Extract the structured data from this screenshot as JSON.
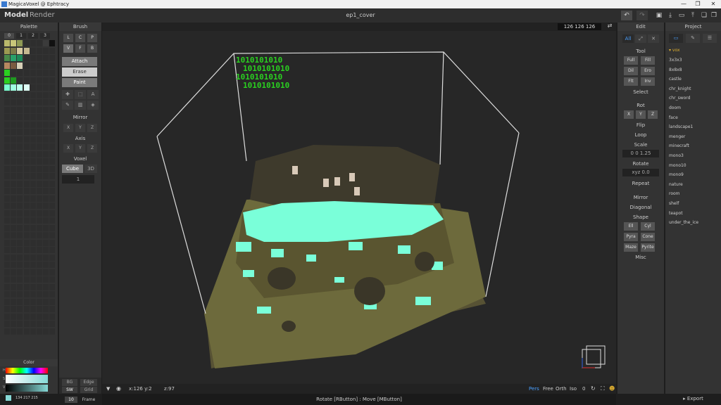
{
  "titlebar": {
    "title": "MagicaVoxel @ Ephtracy",
    "controls": [
      "—",
      "❐",
      "✕"
    ]
  },
  "menubar": {
    "model": "Model",
    "render": "Render",
    "file_title": "ep1_cover"
  },
  "palette": {
    "header": "Palette",
    "tabs": [
      "0",
      "1",
      "2",
      "3"
    ],
    "colors": [
      [
        "#b9b86c",
        "#c8c67a",
        "#8f9a55",
        "#2e2e2e",
        "#2e2e2e",
        "#2e2e2e",
        "#3b3b3b",
        "#111111"
      ],
      [
        "#9c9a52",
        "#7c7a48",
        "#d6c9a0",
        "#c5b890",
        "#2e2e2e",
        "#2e2e2e",
        "#2e2e2e",
        "#2e2e2e"
      ],
      [
        "#4a8a4a",
        "#2aa06a",
        "#1e8a5a",
        "#2e2e2e",
        "#2e2e2e",
        "#2e2e2e",
        "#2e2e2e",
        "#2e2e2e"
      ],
      [
        "#b88860",
        "#7a5a40",
        "#d8d0b8",
        "#2e2e2e",
        "#2e2e2e",
        "#2e2e2e",
        "#2e2e2e",
        "#2e2e2e"
      ],
      [
        "#2ad020",
        "#2e2e2e",
        "#2e2e2e",
        "#2e2e2e",
        "#2e2e2e",
        "#2e2e2e",
        "#2e2e2e",
        "#2e2e2e"
      ],
      [
        "#2ad020",
        "#1e9a20",
        "#2e2e2e",
        "#2e2e2e",
        "#2e2e2e",
        "#2e2e2e",
        "#2e2e2e",
        "#2e2e2e"
      ],
      [
        "#7affd0",
        "#9effe0",
        "#bfffee",
        "#dffff6",
        "#2e2e2e",
        "#2e2e2e",
        "#2e2e2e",
        "#2e2e2e"
      ]
    ],
    "color_header": "Color",
    "color_values": "134 217 215"
  },
  "brush": {
    "header": "Brush",
    "grid": [
      "L",
      "C",
      "P",
      "V",
      "F",
      "B"
    ],
    "actions": [
      "Attach",
      "Erase",
      "Paint"
    ],
    "mirror_label": "Mirror",
    "mirror": [
      "X",
      "Y",
      "Z"
    ],
    "axis_label": "Axis",
    "axis": [
      "X",
      "Y",
      "Z"
    ],
    "voxel_label": "Voxel",
    "voxel_cube": "Cube",
    "voxel_3d": "3D",
    "voxel_value": "1"
  },
  "viewport": {
    "dims": "126 126 126",
    "binary": [
      "1010101010",
      "1010101010",
      "1010101010",
      "1010101010"
    ],
    "cursor": "x:126 y:2",
    "z": "z:97",
    "views": [
      "Pers",
      "Free",
      "Orth",
      "Iso"
    ],
    "zero": "0"
  },
  "leftbottom": {
    "bg": "BG",
    "edge": "Edge",
    "sw": "SW",
    "grid": "Grid",
    "ten": "10",
    "frame": "Frame"
  },
  "edit": {
    "header": "Edit",
    "tabs": [
      "All"
    ],
    "tool_label": "Tool",
    "tools": [
      "Full",
      "Fill",
      "Dil",
      "Ero",
      "Flt",
      "Inv"
    ],
    "select_label": "Select",
    "rot_label": "Rot",
    "rot": [
      "X",
      "Y",
      "Z"
    ],
    "flip_label": "Flip",
    "loop_label": "Loop",
    "scale_label": "Scale",
    "scale_value": "0 0 1.25",
    "rotate_label": "Rotate",
    "rotate_value": "xyz 0.0",
    "repeat_label": "Repeat",
    "mirror_label": "Mirror",
    "diagonal_label": "Diagonal",
    "shape_label": "Shape",
    "shapes": [
      "Ell",
      "Cyl",
      "Pyra",
      "Cone",
      "Maze",
      "Pyrite"
    ],
    "misc_label": "Misc"
  },
  "project": {
    "header": "Project",
    "folder": "vox",
    "items": [
      "3x3x3",
      "8x8x8",
      "castle",
      "chr_knight",
      "chr_sword",
      "doom",
      "face",
      "landscape1",
      "menger",
      "minecraft",
      "mono3",
      "mono10",
      "mono9",
      "nature",
      "room",
      "shelf",
      "teapot",
      "under_the_ice"
    ],
    "export": "Export"
  },
  "status": {
    "hint": "Rotate [RButton] : Move [MButton]"
  },
  "colors": {
    "accent": "#4aa0ff",
    "green_text": "#2ad020",
    "ice": "#7affd9",
    "ground": "#6d6a3c",
    "rock": "#3e3a2c"
  }
}
